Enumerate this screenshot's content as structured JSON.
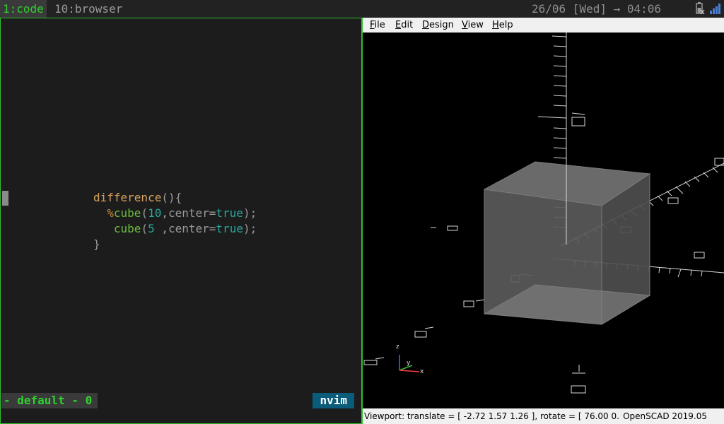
{
  "topbar": {
    "workspaces": [
      {
        "label": "1:code",
        "active": true
      },
      {
        "label": "10:browser",
        "active": false
      }
    ],
    "clock": "26/06 [Wed] → 04:06",
    "tray_icons": [
      "battery-icon",
      "signal-icon"
    ]
  },
  "editor": {
    "code_lines": [
      {
        "tokens": [
          {
            "t": "difference",
            "c": "fn"
          },
          {
            "t": "(){",
            "c": "punc"
          }
        ]
      },
      {
        "tokens": [
          {
            "t": "  ",
            "c": "punc"
          },
          {
            "t": "%",
            "c": "mod"
          },
          {
            "t": "cube",
            "c": "id"
          },
          {
            "t": "(",
            "c": "punc"
          },
          {
            "t": "10",
            "c": "num"
          },
          {
            "t": ",center=",
            "c": "punc"
          },
          {
            "t": "true",
            "c": "bool"
          },
          {
            "t": ");",
            "c": "punc"
          }
        ]
      },
      {
        "tokens": [
          {
            "t": "   ",
            "c": "punc"
          },
          {
            "t": "cube",
            "c": "id"
          },
          {
            "t": "(",
            "c": "punc"
          },
          {
            "t": "5",
            "c": "num"
          },
          {
            "t": " ,center=",
            "c": "punc"
          },
          {
            "t": "true",
            "c": "bool"
          },
          {
            "t": ");",
            "c": "punc"
          }
        ]
      },
      {
        "tokens": [
          {
            "t": "}",
            "c": "punc"
          }
        ]
      }
    ],
    "status_session": "- default - 0",
    "status_mode": "nvim"
  },
  "openscad": {
    "menu": [
      {
        "label": "File",
        "underline": "F",
        "rest": "ile"
      },
      {
        "label": "Edit",
        "underline": "E",
        "rest": "dit"
      },
      {
        "label": "Design",
        "underline": "D",
        "rest": "esign"
      },
      {
        "label": "View",
        "underline": "V",
        "rest": "iew"
      },
      {
        "label": "Help",
        "underline": "H",
        "rest": "elp"
      }
    ],
    "status_left": "Viewport: translate = [ -2.72 1.57 1.26 ], rotate = [ 76.00 0.",
    "status_right": "OpenSCAD 2019.05",
    "axes_labels": {
      "z": "z",
      "y": "y",
      "x": "x"
    }
  },
  "colors": {
    "accent_green": "#2fd12f",
    "mode_bg": "#0b5c7a"
  }
}
